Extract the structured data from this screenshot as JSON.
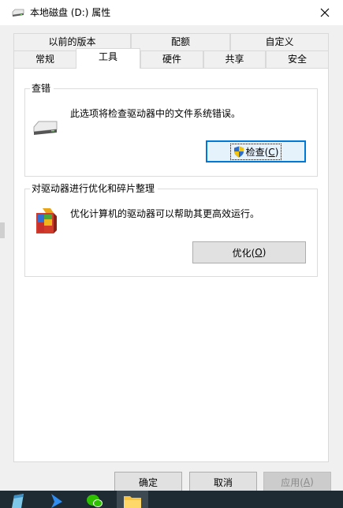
{
  "window": {
    "title": "本地磁盘 (D:) 属性",
    "close_label": "×"
  },
  "tabs": {
    "row1": [
      {
        "label": "以前的版本"
      },
      {
        "label": "配额"
      },
      {
        "label": "自定义"
      }
    ],
    "row2": [
      {
        "label": "常规"
      },
      {
        "label": "工具",
        "selected": true
      },
      {
        "label": "硬件"
      },
      {
        "label": "共享"
      },
      {
        "label": "安全"
      }
    ]
  },
  "check_group": {
    "title": "查错",
    "description": "此选项将检查驱动器中的文件系统错误。",
    "button_text": "检查(",
    "button_accel": "C",
    "button_tail": ")",
    "icon": "drive-icon"
  },
  "optimize_group": {
    "title": "对驱动器进行优化和碎片整理",
    "description": "优化计算机的驱动器可以帮助其更高效运行。",
    "button_text": "优化(",
    "button_accel": "O",
    "button_tail": ")",
    "icon": "defrag-icon"
  },
  "footer": {
    "ok": "确定",
    "cancel": "取消",
    "apply_text": "应用(",
    "apply_accel": "A",
    "apply_tail": ")"
  },
  "taskbar": {
    "items": [
      "notepad-icon",
      "feishu-icon",
      "wechat-icon",
      "file-explorer-icon"
    ]
  },
  "colors": {
    "focus_blue": "#0078d7",
    "dialog_bg": "#f0f0f0",
    "taskbar_bg": "#1f2b33"
  }
}
